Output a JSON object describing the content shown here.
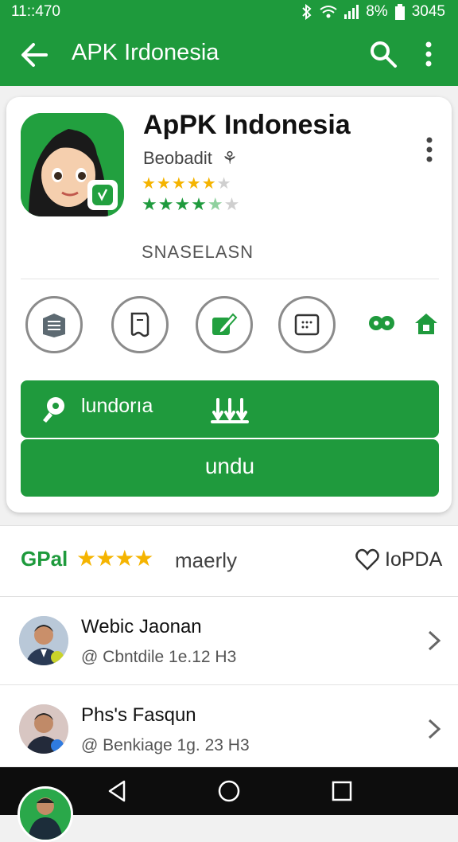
{
  "status_bar": {
    "time": "11::470",
    "battery": "8%",
    "clock_right": "3045"
  },
  "app_bar": {
    "title": "APK Irdonesia"
  },
  "app": {
    "name": "ApPK Indonesia",
    "developer": "Beobadit",
    "category": "SNASELASN",
    "rating_stars_1": 4.5,
    "rating_stars_2": 3.5
  },
  "actions": {
    "primary_label": "lundorıa",
    "secondary_label": "undu"
  },
  "rating_bar": {
    "brand": "GPal",
    "stars": 4,
    "word": "maerly",
    "favorite_label": "IoPDA"
  },
  "list": [
    {
      "name": "Webic Jaonan",
      "sub": "@ Cbntdile 1e.12 H3"
    },
    {
      "name": "Phs's Fasqun",
      "sub": "@ Benkiage 1g. 23 H3"
    }
  ],
  "colors": {
    "primary": "#1e9a3c",
    "star": "#f5b400",
    "star_green": "#1f9a3d"
  }
}
